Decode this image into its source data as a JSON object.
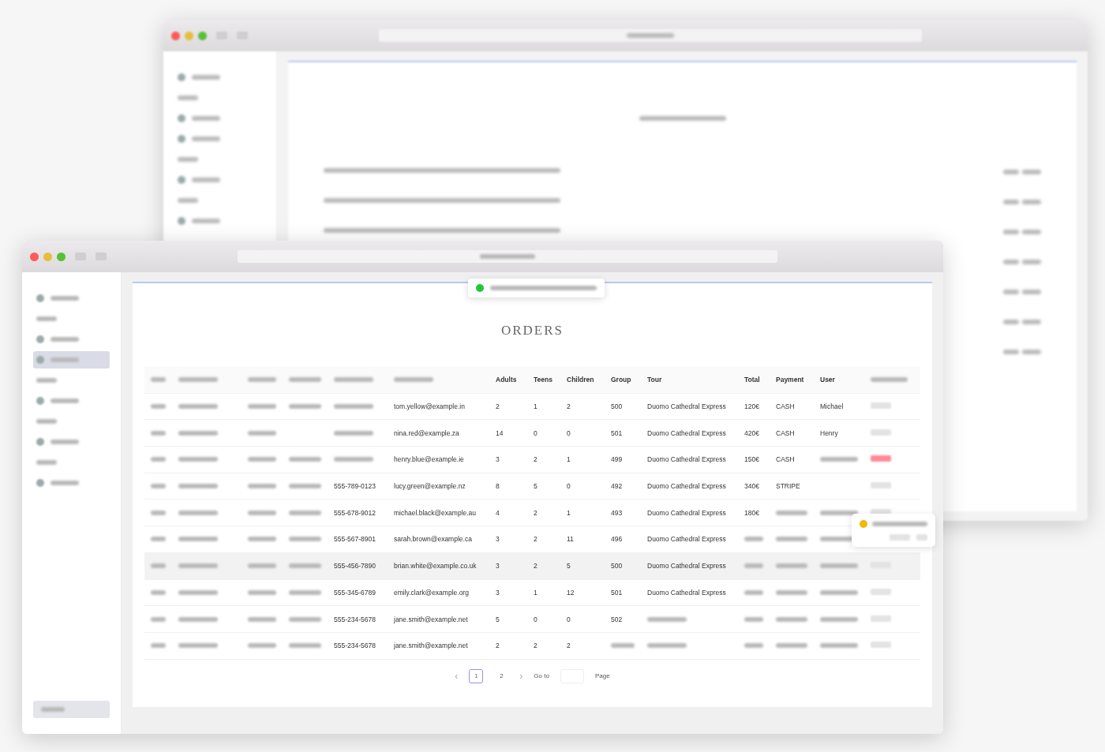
{
  "back_window": {
    "sidebar": [
      {
        "kind": "item"
      },
      {
        "kind": "section"
      },
      {
        "kind": "item"
      },
      {
        "kind": "item"
      },
      {
        "kind": "section"
      },
      {
        "kind": "item"
      },
      {
        "kind": "section"
      },
      {
        "kind": "item"
      }
    ]
  },
  "window": {
    "sidebar": [
      {
        "kind": "item",
        "selected": false
      },
      {
        "kind": "section"
      },
      {
        "kind": "item",
        "selected": false
      },
      {
        "kind": "item",
        "selected": true
      },
      {
        "kind": "section"
      },
      {
        "kind": "item",
        "selected": false
      },
      {
        "kind": "section"
      },
      {
        "kind": "item",
        "selected": false
      },
      {
        "kind": "section"
      },
      {
        "kind": "item",
        "selected": false
      }
    ],
    "toast": {
      "color": "#1fc93a"
    },
    "title": "ORDERS",
    "table": {
      "columns": [
        {
          "kind": "blurred"
        },
        {
          "kind": "blurred"
        },
        {
          "kind": "blurred"
        },
        {
          "kind": "blurred"
        },
        {
          "kind": "blurred"
        },
        {
          "kind": "blurred"
        },
        "Adults",
        "Teens",
        "Children",
        "Group",
        "Tour",
        "Total",
        "Payment",
        "User",
        {
          "kind": "blurred"
        }
      ],
      "rows": [
        {
          "hover": false,
          "cells": [
            {
              "kind": "blurred"
            },
            {
              "kind": "blurred"
            },
            {
              "kind": "blurred"
            },
            {
              "kind": "blurred"
            },
            {
              "kind": "blurred"
            },
            "tom.yellow@example.in",
            "2",
            "1",
            "2",
            "500",
            "Duomo Cathedral Express",
            "120€",
            "CASH",
            "Michael",
            {
              "kind": "action",
              "danger": false
            }
          ]
        },
        {
          "hover": false,
          "cells": [
            {
              "kind": "blurred"
            },
            {
              "kind": "blurred"
            },
            {
              "kind": "blurred"
            },
            {
              "kind": "blank"
            },
            {
              "kind": "blurred"
            },
            "nina.red@example.za",
            "14",
            "0",
            "0",
            "501",
            "Duomo Cathedral Express",
            "420€",
            "CASH",
            "Henry",
            {
              "kind": "action",
              "danger": false
            }
          ]
        },
        {
          "hover": false,
          "cells": [
            {
              "kind": "blurred"
            },
            {
              "kind": "blurred"
            },
            {
              "kind": "blurred"
            },
            {
              "kind": "blurred"
            },
            {
              "kind": "blurred"
            },
            "henry.blue@example.ie",
            "3",
            "2",
            "1",
            "499",
            "Duomo Cathedral Express",
            "150€",
            "CASH",
            {
              "kind": "blurred"
            },
            {
              "kind": "action",
              "danger": true
            }
          ]
        },
        {
          "hover": false,
          "cells": [
            {
              "kind": "blurred"
            },
            {
              "kind": "blurred"
            },
            {
              "kind": "blurred"
            },
            {
              "kind": "blurred"
            },
            "555-789-0123",
            "lucy.green@example.nz",
            "8",
            "5",
            "0",
            "492",
            "Duomo Cathedral Express",
            "340€",
            "STRIPE",
            {
              "kind": "blank"
            },
            {
              "kind": "action",
              "danger": false
            }
          ]
        },
        {
          "hover": false,
          "cells": [
            {
              "kind": "blurred"
            },
            {
              "kind": "blurred"
            },
            {
              "kind": "blurred"
            },
            {
              "kind": "blurred"
            },
            "555-678-9012",
            "michael.black@example.au",
            "4",
            "2",
            "1",
            "493",
            "Duomo Cathedral Express",
            "180€",
            {
              "kind": "blurred"
            },
            {
              "kind": "blurred"
            },
            {
              "kind": "action",
              "danger": false
            }
          ]
        },
        {
          "hover": false,
          "cells": [
            {
              "kind": "blurred"
            },
            {
              "kind": "blurred"
            },
            {
              "kind": "blurred"
            },
            {
              "kind": "blurred"
            },
            "555-567-8901",
            "sarah.brown@example.ca",
            "3",
            "2",
            "11",
            "496",
            "Duomo Cathedral Express",
            {
              "kind": "blurred"
            },
            {
              "kind": "blurred"
            },
            {
              "kind": "blurred"
            },
            {
              "kind": "blank"
            }
          ]
        },
        {
          "hover": true,
          "cells": [
            {
              "kind": "blurred"
            },
            {
              "kind": "blurred"
            },
            {
              "kind": "blurred"
            },
            {
              "kind": "blurred"
            },
            "555-456-7890",
            "brian.white@example.co.uk",
            "3",
            "2",
            "5",
            "500",
            "Duomo Cathedral Express",
            {
              "kind": "blurred"
            },
            {
              "kind": "blurred"
            },
            {
              "kind": "blurred"
            },
            {
              "kind": "action",
              "danger": false
            }
          ]
        },
        {
          "hover": false,
          "cells": [
            {
              "kind": "blurred"
            },
            {
              "kind": "blurred"
            },
            {
              "kind": "blurred"
            },
            {
              "kind": "blurred"
            },
            "555-345-6789",
            "emily.clark@example.org",
            "3",
            "1",
            "12",
            "501",
            "Duomo Cathedral Express",
            {
              "kind": "blurred"
            },
            {
              "kind": "blurred"
            },
            {
              "kind": "blurred"
            },
            {
              "kind": "action",
              "danger": false
            }
          ]
        },
        {
          "hover": false,
          "cells": [
            {
              "kind": "blurred"
            },
            {
              "kind": "blurred"
            },
            {
              "kind": "blurred"
            },
            {
              "kind": "blurred"
            },
            "555-234-5678",
            "jane.smith@example.net",
            "5",
            "0",
            "0",
            "502",
            {
              "kind": "blurred"
            },
            {
              "kind": "blurred"
            },
            {
              "kind": "blurred"
            },
            {
              "kind": "blurred"
            },
            {
              "kind": "action",
              "danger": false
            }
          ]
        },
        {
          "hover": false,
          "cells": [
            {
              "kind": "blurred"
            },
            {
              "kind": "blurred"
            },
            {
              "kind": "blurred"
            },
            {
              "kind": "blurred"
            },
            "555-234-5678",
            "jane.smith@example.net",
            "2",
            "2",
            "2",
            {
              "kind": "blurred"
            },
            {
              "kind": "blurred"
            },
            {
              "kind": "blurred"
            },
            {
              "kind": "blurred"
            },
            {
              "kind": "blurred"
            },
            {
              "kind": "action",
              "danger": false
            }
          ]
        }
      ]
    },
    "popconfirm": {
      "color": "#f5b800"
    },
    "pagination": {
      "prev": "‹",
      "pages": [
        {
          "label": "1",
          "selected": true
        },
        {
          "label": "2",
          "selected": false
        }
      ],
      "next": "›",
      "goto": "Go to",
      "page": "Page"
    }
  }
}
